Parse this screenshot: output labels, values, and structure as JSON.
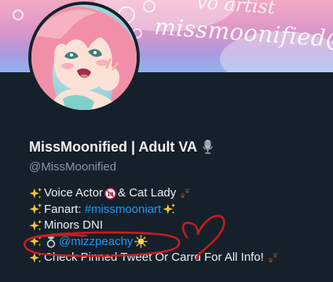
{
  "banner": {
    "script_text": "missmoonified@gmail",
    "script_text_top": "vo artist",
    "colors": {
      "top": "#f3a8c4",
      "bottom": "#8fb3ef"
    }
  },
  "profile": {
    "display_name": "MissMoonified | Adult VA",
    "handle": "@MissMoonified",
    "name_icon": "microphone-icon"
  },
  "bio": {
    "line1": {
      "icon": "sparkles-icon",
      "text_a": "Voice Actor",
      "badge": "no-one-under-18-icon",
      "text_b": "& Cat Lady",
      "trail_icon": "paw-prints-icon"
    },
    "line2": {
      "icon": "sparkles-icon",
      "text": "Fanart: ",
      "hashtag": "#missmooniart",
      "trail_icon": "sparkles-icon"
    },
    "line3": {
      "icon": "sparkles-icon",
      "text": "Minors DNI"
    },
    "line4": {
      "icon": "sparkles-icon",
      "ring_icon": "ring-icon",
      "mention": "@mizzpeachy",
      "trail_icon": "sun-icon"
    },
    "line5": {
      "icon": "sparkles-icon",
      "text": "Check Pinned Tweet Or Carrd For All Info!",
      "trail_icon": "paw-prints-icon"
    }
  },
  "annotation": {
    "color": "#cc1f1f",
    "shapes": [
      "circle-around-mention",
      "heart"
    ]
  }
}
